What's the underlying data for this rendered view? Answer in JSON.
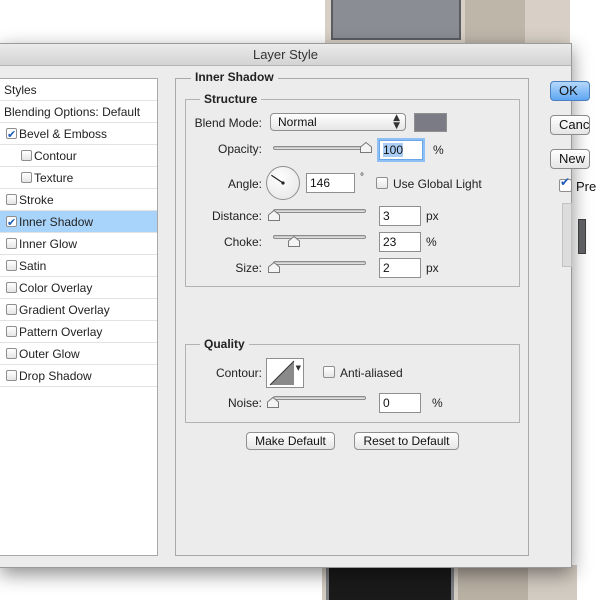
{
  "window": {
    "title": "Layer Style"
  },
  "styles_list": {
    "header": "Styles",
    "blending": "Blending Options: Default",
    "items": [
      {
        "label": "Bevel & Emboss",
        "checked": true,
        "indent": false,
        "selected": false
      },
      {
        "label": "Contour",
        "checked": false,
        "indent": true,
        "selected": false
      },
      {
        "label": "Texture",
        "checked": false,
        "indent": true,
        "selected": false
      },
      {
        "label": "Stroke",
        "checked": false,
        "indent": false,
        "selected": false
      },
      {
        "label": "Inner Shadow",
        "checked": true,
        "indent": false,
        "selected": true
      },
      {
        "label": "Inner Glow",
        "checked": false,
        "indent": false,
        "selected": false
      },
      {
        "label": "Satin",
        "checked": false,
        "indent": false,
        "selected": false
      },
      {
        "label": "Color Overlay",
        "checked": false,
        "indent": false,
        "selected": false
      },
      {
        "label": "Gradient Overlay",
        "checked": false,
        "indent": false,
        "selected": false
      },
      {
        "label": "Pattern Overlay",
        "checked": false,
        "indent": false,
        "selected": false
      },
      {
        "label": "Outer Glow",
        "checked": false,
        "indent": false,
        "selected": false
      },
      {
        "label": "Drop Shadow",
        "checked": false,
        "indent": false,
        "selected": false
      }
    ]
  },
  "inner_shadow": {
    "section_title": "Inner Shadow",
    "structure": {
      "title": "Structure",
      "blend_mode_label": "Blend Mode:",
      "blend_mode_value": "Normal",
      "color_swatch": "#7a7b85",
      "opacity_label": "Opacity:",
      "opacity_value": "100",
      "opacity_unit": "%",
      "opacity_fraction": 1.0,
      "angle_label": "Angle:",
      "angle_value": "146",
      "angle_unit": "°",
      "angle_degrees": 146,
      "use_global_light_label": "Use Global Light",
      "use_global_light": false,
      "distance_label": "Distance:",
      "distance_value": "3",
      "distance_unit": "px",
      "distance_fraction": 0.01,
      "choke_label": "Choke:",
      "choke_value": "23",
      "choke_unit": "%",
      "choke_fraction": 0.23,
      "size_label": "Size:",
      "size_value": "2",
      "size_unit": "px",
      "size_fraction": 0.01
    },
    "quality": {
      "title": "Quality",
      "contour_label": "Contour:",
      "anti_aliased_label": "Anti-aliased",
      "anti_aliased": false,
      "noise_label": "Noise:",
      "noise_value": "0",
      "noise_unit": "%",
      "noise_fraction": 0.0
    },
    "make_default_label": "Make Default",
    "reset_default_label": "Reset to Default"
  },
  "right_panel": {
    "ok_label": "OK",
    "cancel_label": "Cancel",
    "new_style_label": "New Style...",
    "preview_label": "Preview",
    "preview_checked": true
  },
  "colors": {
    "selection": "#a8d4fb",
    "primary_button": "#5ea6f1",
    "shadow_swatch": "#7a7b85"
  }
}
